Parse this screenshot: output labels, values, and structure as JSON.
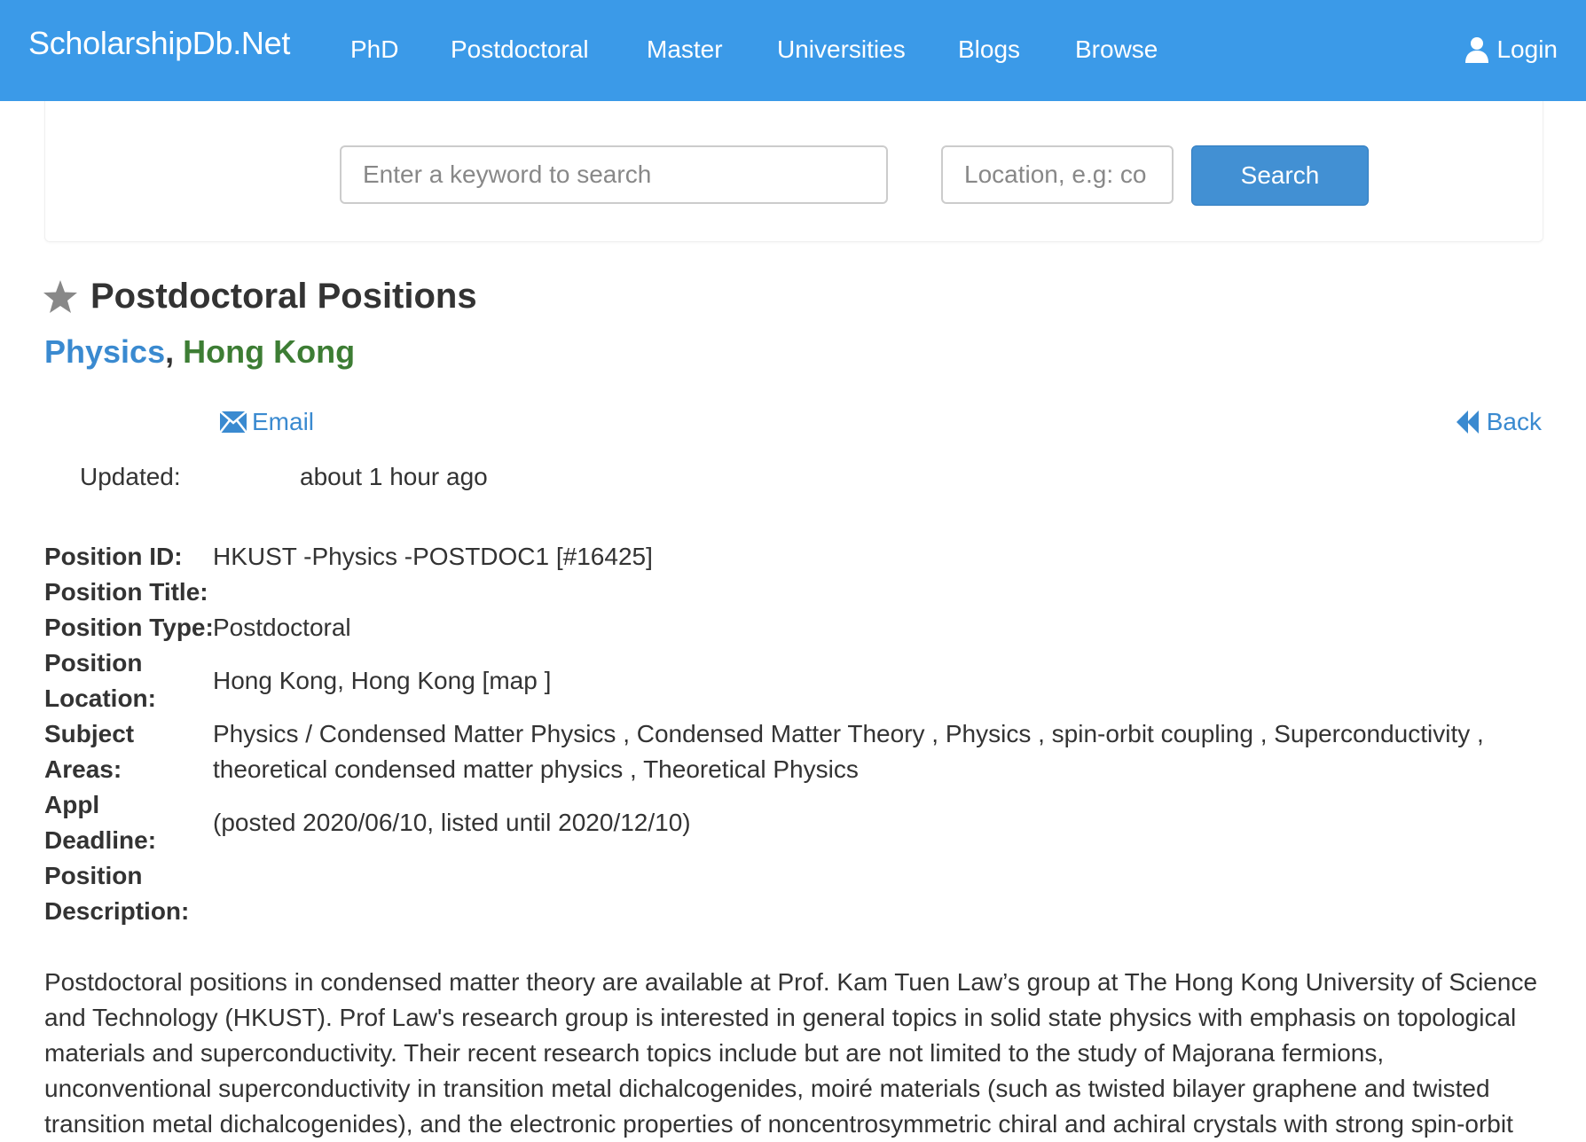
{
  "nav": {
    "brand": "ScholarshipDb.Net",
    "links": [
      "PhD",
      "Postdoctoral",
      "Master",
      "Universities",
      "Blogs",
      "Browse"
    ],
    "login": "Login"
  },
  "search": {
    "keyword_placeholder": "Enter a keyword to search",
    "location_placeholder": "Location, e.g: co",
    "button": "Search"
  },
  "page": {
    "title": "Postdoctoral Positions",
    "subject": "Physics",
    "separator": ",",
    "location": "Hong Kong"
  },
  "actions": {
    "email": "Email",
    "back": "Back"
  },
  "updated": {
    "label": "Updated:",
    "value": "about 1 hour ago"
  },
  "details": [
    {
      "label": "Position ID:",
      "value": "HKUST -Physics -POSTDOC1 [#16425]"
    },
    {
      "label": "Position Title:",
      "value": ""
    },
    {
      "label": "Position Type:",
      "value": "Postdoctoral"
    },
    {
      "label": "Position Location:",
      "value": "Hong Kong, Hong Kong [map ]"
    },
    {
      "label": "Subject Areas:",
      "value": "Physics / Condensed Matter Physics , Condensed Matter Theory , Physics , spin-orbit coupling , Superconductivity , theoretical condensed matter physics , Theoretical Physics"
    },
    {
      "label": "Appl Deadline:",
      "value": "(posted 2020/06/10, listed until 2020/12/10)"
    },
    {
      "label": "Position Description:",
      "value": ""
    }
  ],
  "description": "Postdoctoral positions in condensed matter theory are available at Prof. Kam Tuen Law’s group at The Hong Kong University of Science and Technology (HKUST). Prof Law's research group is interested in general topics in solid state physics with emphasis on topological materials and superconductivity. Their recent research topics include but are not limited to the study of Majorana fermions, unconventional superconductivity in transition metal dichalcogenides, moiré materials (such as twisted bilayer graphene and twisted transition metal dichalcogenides), and the electronic properties of noncentrosymmetric chiral and achiral crystals with strong spin-orbit",
  "colors": {
    "navbar": "#3b9ae8",
    "search_button": "#4290d3",
    "subject_link": "#3a8ad0",
    "location_link": "#3d7d34"
  },
  "icons": [
    "user-icon",
    "star-icon",
    "envelope-icon",
    "backward-icon"
  ]
}
